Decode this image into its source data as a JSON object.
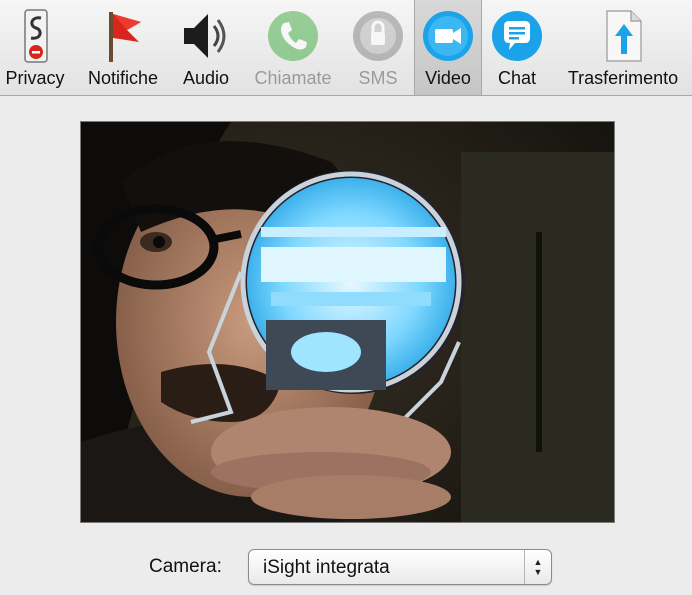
{
  "toolbar": {
    "items": [
      {
        "label": "Privacy",
        "icon": "privacy-sign-icon"
      },
      {
        "label": "Notifiche",
        "icon": "red-flag-icon"
      },
      {
        "label": "Audio",
        "icon": "speaker-icon"
      },
      {
        "label": "Chiamate",
        "icon": "phone-icon"
      },
      {
        "label": "SMS",
        "icon": "sms-icon"
      },
      {
        "label": "Video",
        "icon": "video-camera-icon"
      },
      {
        "label": "Chat",
        "icon": "chat-bubble-icon"
      },
      {
        "label": "Trasferimento",
        "icon": "file-transfer-icon"
      }
    ],
    "selected": "Video",
    "disabled": [
      "Chiamate",
      "SMS"
    ]
  },
  "camera": {
    "label": "Camera:",
    "value": "iSight integrata"
  },
  "colors": {
    "skype_blue": "#1aa3e8",
    "phone_green": "#4cb04c",
    "flag_red": "#d8261d"
  }
}
